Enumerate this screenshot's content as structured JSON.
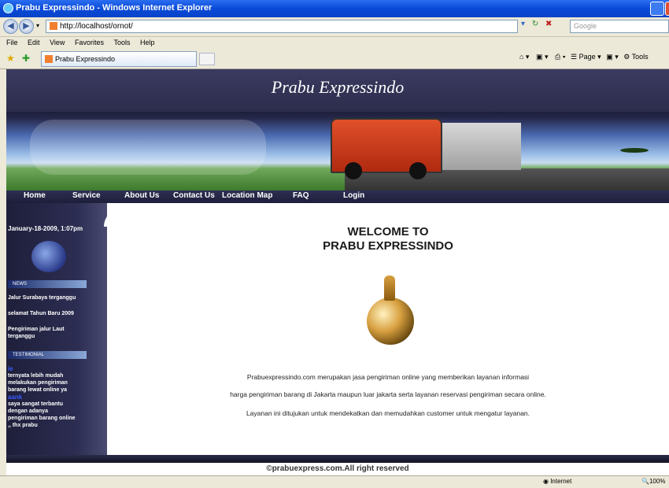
{
  "browser": {
    "window_title": "Prabu Expressindo - Windows Internet Explorer",
    "address": "http://localhost/ornot/",
    "search_placeholder": "Google",
    "menu": [
      "File",
      "Edit",
      "View",
      "Favorites",
      "Tools",
      "Help"
    ],
    "tab_title": "Prabu Expressindo",
    "toolbar": {
      "page_label": "Page",
      "tools_label": "Tools"
    },
    "status": {
      "zone": "Internet",
      "zoom": "100%"
    }
  },
  "site": {
    "logo_text": "Prabu Expressindo",
    "nav": [
      "Home",
      "Service",
      "About Us",
      "Contact Us",
      "Location Map",
      "FAQ",
      "Login"
    ],
    "sidebar": {
      "date": "January-18-2009, 1:07pm",
      "news_header": "NEWS",
      "news": [
        "Jalur Surabaya terganggu",
        "selamat Tahun Baru 2009",
        "Pengiriman jalur Laut terganggu"
      ],
      "testimonial_header": "TESTIMONIAL",
      "testimonials": [
        {
          "name": "ie",
          "text": "ternyata lebih mudah melakukan pengiriman barang lewat online ya"
        },
        {
          "name": "aank",
          "text": "saya sangat terbantu dengan adanya pengiriman barang online ,, thx prabu"
        }
      ]
    },
    "welcome_line1": "WELCOME TO",
    "welcome_line2": "PRABU EXPRESSINDO",
    "paragraphs": [
      "Prabuexpressindo.com merupakan jasa pengiriman online yang memberikan layanan informasi",
      "harga pengiriman barang di Jakarta maupun luar jakarta serta layanan reservasi pengiriman secara online.",
      "Layanan ini ditujukan untuk mendekatkan dan memudahkan customer untuk mengatur layanan."
    ],
    "footer": "©prabuexpress.com.All right reserved"
  }
}
